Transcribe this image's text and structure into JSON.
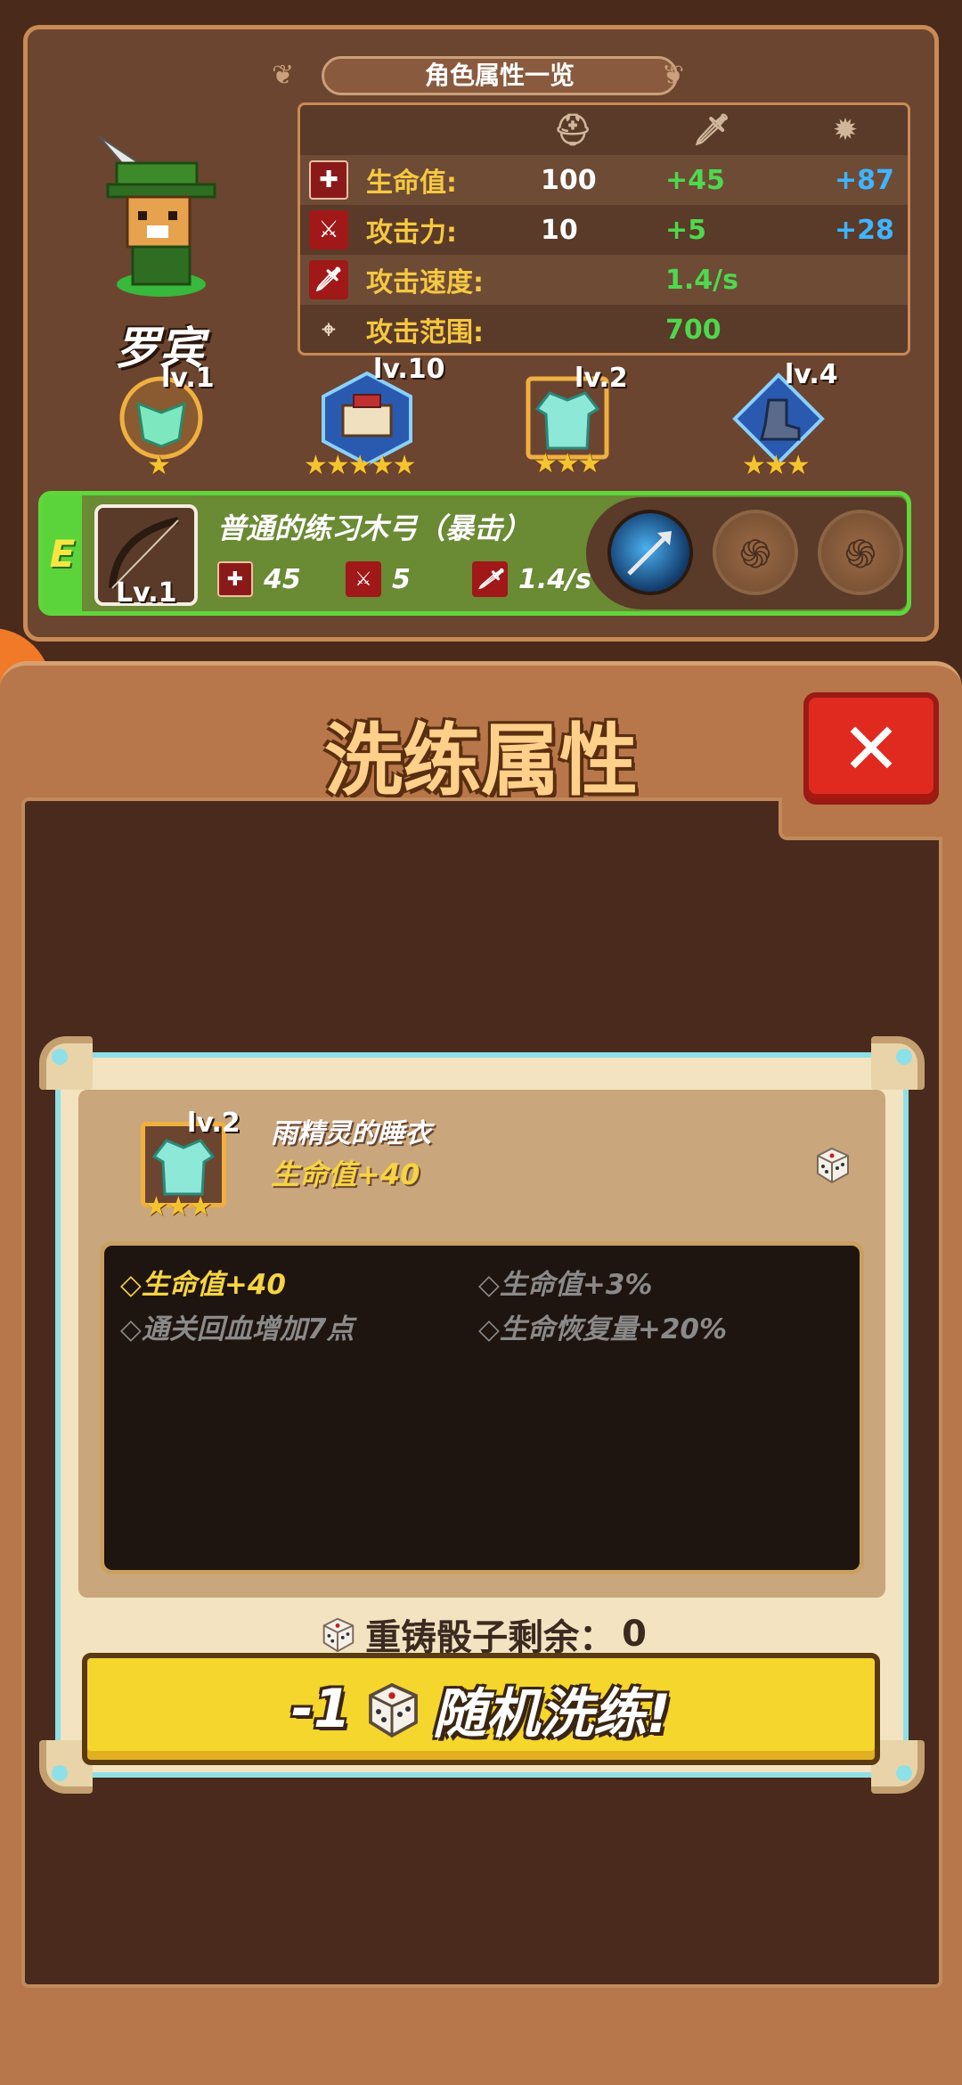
{
  "attr_panel": {
    "header": "角色属性一览",
    "rows": [
      {
        "icon": "heart-icon",
        "label": "生命值:",
        "base": "100",
        "bonus_green": "+45",
        "bonus_blue": "+87"
      },
      {
        "icon": "sword-icon",
        "label": "攻击力:",
        "base": "10",
        "bonus_green": "+5",
        "bonus_blue": "+28"
      },
      {
        "icon": "speed-sword-icon",
        "label": "攻击速度:",
        "base": "",
        "bonus_green": "1.4/s",
        "bonus_blue": ""
      },
      {
        "icon": "crosshair-icon",
        "label": "攻击范围:",
        "base": "",
        "bonus_green": "700",
        "bonus_blue": ""
      }
    ],
    "column_icons": [
      "helmet-icon",
      "sword-icon",
      "burst-icon"
    ]
  },
  "hero": {
    "name": "罗宾"
  },
  "equipment": [
    {
      "name": "leaf-armor",
      "level": "lv.1",
      "stars": 1
    },
    {
      "name": "book-trinket",
      "level": "lv.10",
      "stars": 5
    },
    {
      "name": "pajama-shirt",
      "level": "lv.2",
      "stars": 3
    },
    {
      "name": "boots",
      "level": "lv.4",
      "stars": 3
    }
  ],
  "weapon": {
    "grade": "E",
    "level": "Lv.1",
    "name": "普通的练习木弓（暴击）",
    "stats": {
      "hp": "45",
      "attack": "5",
      "speed": "1.4/s"
    },
    "skills": [
      "arrow-skill-icon",
      "locked-skill-icon",
      "locked-skill-icon"
    ]
  },
  "dialog": {
    "title": "洗练属性",
    "close_label": "✕",
    "item": {
      "level": "lv.2",
      "name": "雨精灵的睡衣",
      "main_attr": "生命值+40",
      "stars": 3
    },
    "props": [
      {
        "text": "◇生命值+40",
        "active": true
      },
      {
        "text": "◇生命值+3%",
        "active": false
      },
      {
        "text": "◇通关回血增加7点",
        "active": false
      },
      {
        "text": "◇生命恢复量+20%",
        "active": false
      }
    ],
    "dice_remaining_label": "重铸骰子剩余：",
    "dice_remaining_value": "0",
    "reroll_cost": "-1",
    "reroll_label": "随机洗练!"
  },
  "colors": {
    "accent_gold": "#f5d442",
    "green_bonus": "#4ed84e",
    "blue_bonus": "#3fb4ff",
    "close_red": "#e02a20",
    "button_yellow": "#f5d62c"
  }
}
